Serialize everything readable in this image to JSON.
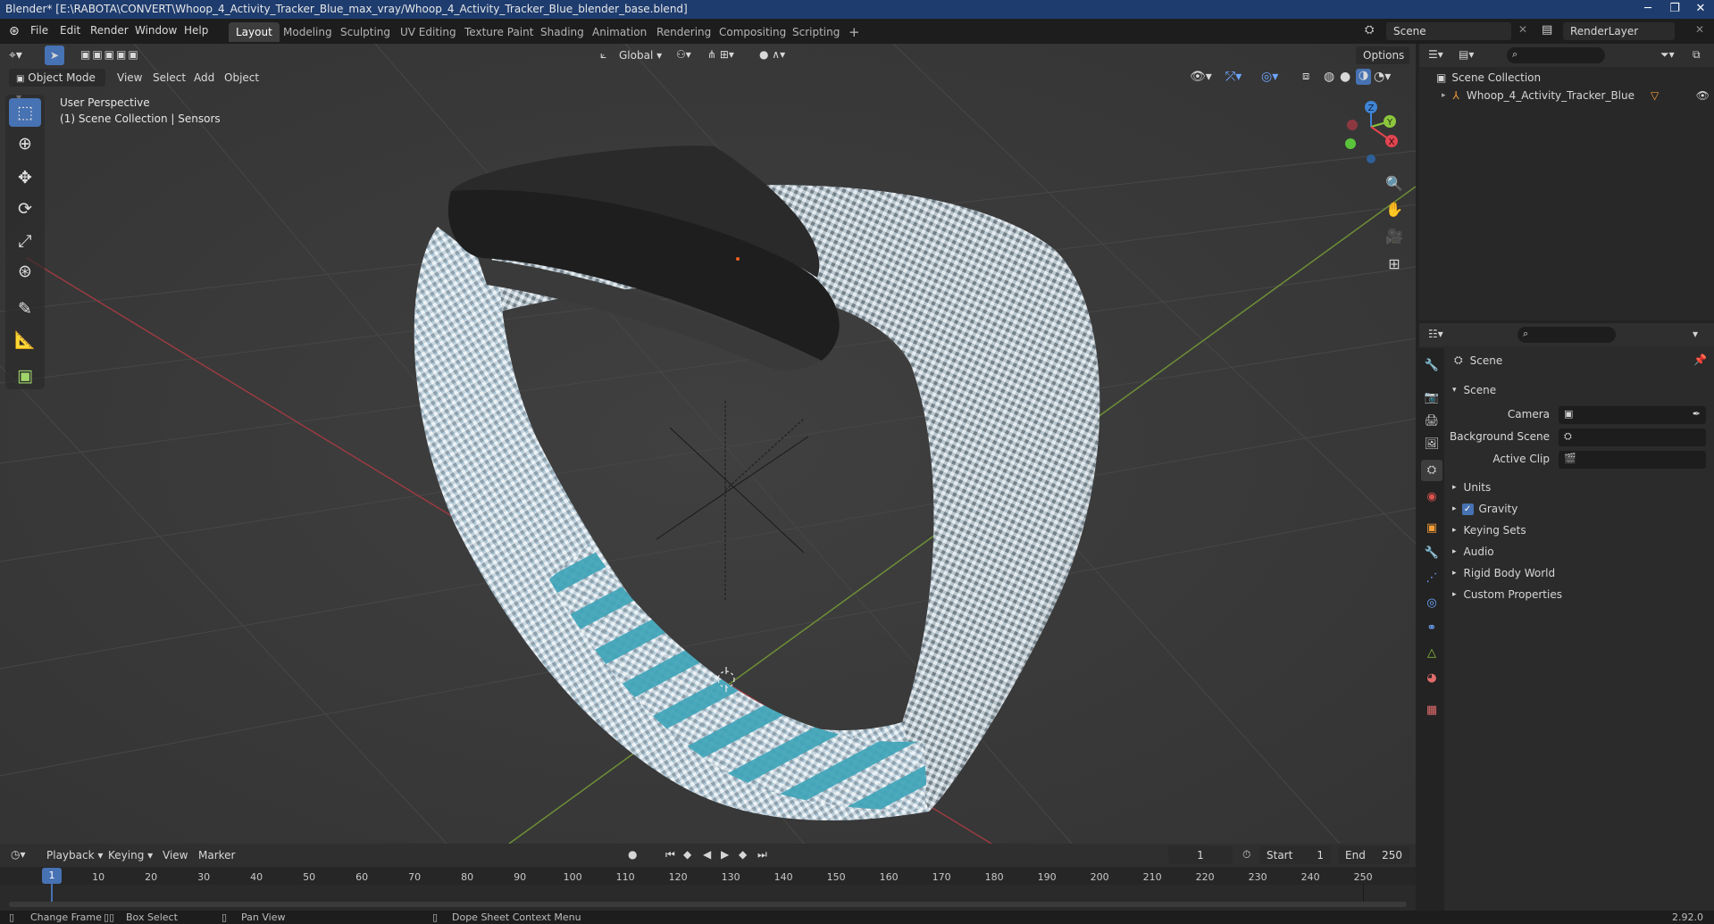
{
  "window": {
    "title": "Blender* [E:\\RABOTA\\CONVERT\\Whoop_4_Activity_Tracker_Blue_max_vray/Whoop_4_Activity_Tracker_Blue_blender_base.blend]",
    "minimize": "─",
    "maximize": "❐",
    "close": "✕"
  },
  "menu": [
    "File",
    "Edit",
    "Render",
    "Window",
    "Help"
  ],
  "workspaces": [
    "Layout",
    "Modeling",
    "Sculpting",
    "UV Editing",
    "Texture Paint",
    "Shading",
    "Animation",
    "Rendering",
    "Compositing",
    "Scripting"
  ],
  "workspace_add": "+",
  "top_right": {
    "scene": "Scene",
    "render_layer": "RenderLayer"
  },
  "viewport_header": {
    "transform_orientation": "Global",
    "options": "Options",
    "mode": "Object Mode",
    "menus": [
      "View",
      "Select",
      "Add",
      "Object"
    ]
  },
  "viewport_overlay": {
    "perspective": "User Perspective",
    "collection": "(1) Scene Collection | Sensors"
  },
  "gizmo": {
    "z": "Z",
    "y": "Y",
    "x": "X"
  },
  "outliner": {
    "root": "Scene Collection",
    "items": [
      {
        "label": "Whoop_4_Activity_Tracker_Blue"
      }
    ]
  },
  "properties": {
    "context": "Scene",
    "panel_title": "Scene",
    "fields": [
      {
        "label": "Camera"
      },
      {
        "label": "Background Scene"
      },
      {
        "label": "Active Clip"
      }
    ],
    "sections": [
      {
        "label": "Units",
        "checkbox": false
      },
      {
        "label": "Gravity",
        "checkbox": true
      },
      {
        "label": "Keying Sets",
        "checkbox": false
      },
      {
        "label": "Audio",
        "checkbox": false
      },
      {
        "label": "Rigid Body World",
        "checkbox": false
      },
      {
        "label": "Custom Properties",
        "checkbox": false
      }
    ]
  },
  "timeline": {
    "menus": [
      "Playback",
      "Keying",
      "View",
      "Marker"
    ],
    "current_frame": "1",
    "start_label": "Start",
    "start": "1",
    "end_label": "End",
    "end": "250",
    "ticks": [
      "10",
      "20",
      "30",
      "40",
      "50",
      "60",
      "70",
      "80",
      "90",
      "100",
      "110",
      "120",
      "130",
      "140",
      "150",
      "160",
      "170",
      "180",
      "190",
      "200",
      "210",
      "220",
      "230",
      "240",
      "250"
    ],
    "playhead": "1"
  },
  "statusbar": {
    "change_frame": "Change Frame",
    "box_select": "Box Select",
    "pan_view": "Pan View",
    "context_menu": "Dope Sheet Context Menu",
    "version": "2.92.0"
  },
  "colors": {
    "selection": "#4772b3",
    "x_axis": "#e04550",
    "y_axis": "#8cc63e",
    "z_axis": "#3f85d6",
    "band_light": "#c4d3dc",
    "band_stripe": "#3ea3b8"
  }
}
